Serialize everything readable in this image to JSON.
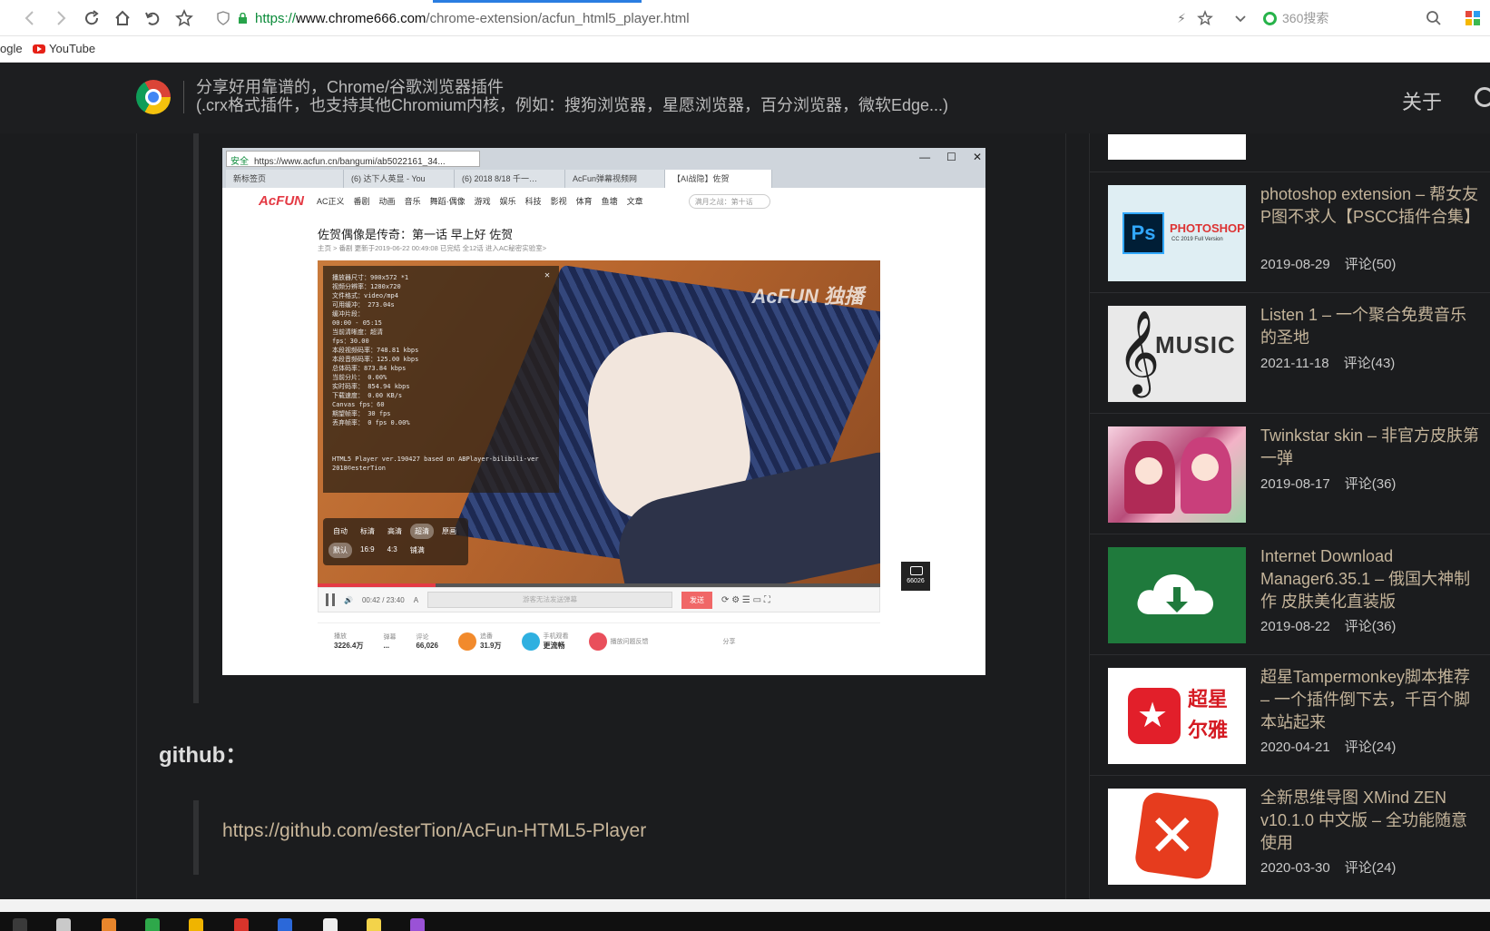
{
  "browser": {
    "url_scheme": "https://",
    "url_host": "www.chrome666.com",
    "url_path": "/chrome-extension/acfun_html5_player.html",
    "search_placeholder": "360搜索",
    "bookmarks": [
      {
        "label": "ogle"
      },
      {
        "label": "YouTube"
      }
    ]
  },
  "site": {
    "tagline_line1": "分享好用靠谱的，Chrome/谷歌浏览器插件",
    "tagline_line2": "(.crx格式插件，也支持其他Chromium内核，例如：搜狗浏览器，星愿浏览器，百分浏览器，微软Edge...)",
    "nav_about": "关于"
  },
  "article": {
    "github_heading": "github：",
    "github_link": "https://github.com/esterTion/AcFun-HTML5-Player"
  },
  "screenshot": {
    "addr_safe": "安全",
    "addr_url": "https://www.acfun.cn/bangumi/ab5022161_34...",
    "tabs": [
      "新标签页",
      "(6) 达下人英显 - You",
      "(6) 2018 8/18 千一…",
      "AcFun弹幕视频网",
      "【AI战隐】佐贺"
    ],
    "nav_logo": "AcFUN",
    "nav_items": [
      "AC正义",
      "番剧",
      "动画",
      "音乐",
      "舞蹈·偶像",
      "游戏",
      "娱乐",
      "科技",
      "影视",
      "体育",
      "鱼塘",
      "文章"
    ],
    "nav_search": "满月之战：第十话",
    "title": "佐贺偶像是传奇：第一话 早上好 佐贺",
    "meta": "主页 > 番剧   更新于2019-06-22 00:49:08   已完结   全12话   进入AC秘密实验室>",
    "watermark": "AcFUN 独播",
    "stats_lines": [
      "播放器尺寸：900x572 *1",
      "视频分辨率：1280x720",
      "文件格式：video/mp4",
      "可用缓冲：              273.04s",
      "缓冲片段：",
      "              00:00 - 05:15",
      "当前清晰度：超清",
      "fps：30.00",
      "本段视频码率：748.81 kbps",
      "本段音频码率：125.00 kbps",
      "总体码率：873.84 kbps",
      "当前分片：              0.00%",
      "实时码率：              854.94 kbps",
      "下载速度：              0.00 KB/s",
      "Canvas fps：60",
      "期望帧率：              30 fps",
      "丢弃帧率：              0 fps 0.00%"
    ],
    "player_version": "HTML5 Player ver.190427 based on ABPlayer-bilibili-ver",
    "player_author": "2018©esterTion",
    "quality_row1": [
      "自动",
      "标清",
      "高清",
      "超清",
      "原画"
    ],
    "quality_selected": "超清",
    "quality_row2": [
      "默认",
      "16:9",
      "4:3",
      "铺满"
    ],
    "time": "00:42 / 23:40",
    "dm_placeholder": "游客无法发送弹幕",
    "send": "发送",
    "dm_count": "66026",
    "info": {
      "plays_label": "播放",
      "plays": "3226.4万",
      "danmaku_label": "弹幕",
      "danmaku": "...",
      "comments_label": "评论",
      "comments": "66,026",
      "fav_label": "追番",
      "fav": "31.9万",
      "mobile_label": "手机观看",
      "mobile_sub": "更流畅",
      "report_label": "播放问题反馈",
      "share_label": "分享"
    }
  },
  "sidebar": {
    "items": [
      {
        "title": "photoshop extension – 帮女友P图不求人【PSCC插件合集】",
        "date": "2019-08-29",
        "comments": "评论(50)",
        "thumb_text": "PHOTOSHOP",
        "thumb_sub": "CC 2019 Full Version",
        "thumb_badge": "Ps"
      },
      {
        "title": "Listen 1 – 一个聚合免费音乐的圣地",
        "date": "2021-11-18",
        "comments": "评论(43)",
        "thumb_text": "MUSIC"
      },
      {
        "title": "Twinkstar skin – 非官方皮肤第一弹",
        "date": "2019-08-17",
        "comments": "评论(36)"
      },
      {
        "title": "Internet Download Manager6.35.1 – 俄国大神制作 皮肤美化直装版",
        "date": "2019-08-22",
        "comments": "评论(36)"
      },
      {
        "title": "超星Tampermonkey脚本推荐 – 一个插件倒下去，千百个脚本站起来",
        "date": "2020-04-21",
        "comments": "评论(24)",
        "thumb_text": "超星 尔雅"
      },
      {
        "title": "全新思维导图 XMind ZEN v10.1.0 中文版 – 全功能随意使用",
        "date": "2020-03-30",
        "comments": "评论(24)"
      }
    ]
  },
  "colors": {
    "page_bg": "#1b1c1e",
    "link": "#c8b69a",
    "accent_red": "#e43a44",
    "url_green": "#0b8b3a"
  }
}
